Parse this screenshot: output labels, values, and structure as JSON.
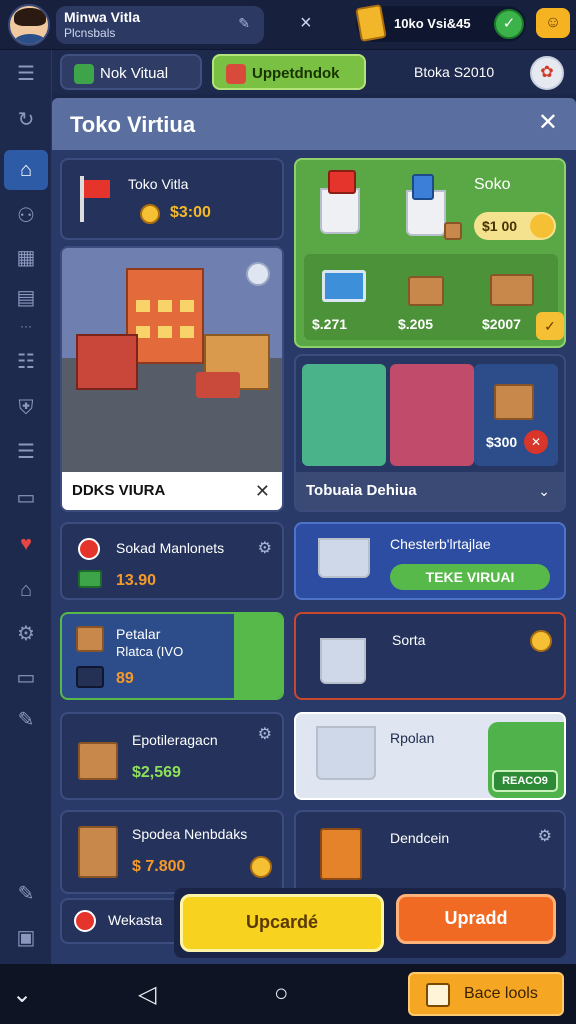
{
  "topbar": {
    "profile_name": "Minwa Vitla",
    "profile_sub": "Plcnsbals",
    "profile_edit_icon": "pencil-icon",
    "close_symbol": "×",
    "balance": "10ko Vsi&45",
    "badge_icon": "checkmark-icon",
    "chat_icon": "chat-bubble-icon",
    "edit_glyph": "✎",
    "badge_glyph": "✓",
    "chat_glyph": "☺"
  },
  "tabs": {
    "store": "Nok Vitual",
    "upgrade": "Uppetdndok",
    "balance": "Btoka S2010",
    "gift_glyph": "✿"
  },
  "sidebar": {
    "items": [
      {
        "name": "menu-icon",
        "glyph": "☰"
      },
      {
        "name": "refresh-icon",
        "glyph": "↻"
      },
      {
        "name": "home-icon",
        "glyph": "⌂"
      },
      {
        "name": "people-icon",
        "glyph": "⚇"
      },
      {
        "name": "building-icon",
        "glyph": "▦"
      },
      {
        "name": "chart-icon",
        "glyph": "▤"
      },
      {
        "name": "dots-icon",
        "glyph": "···"
      },
      {
        "name": "list-icon",
        "glyph": "☷"
      },
      {
        "name": "shield-icon",
        "glyph": "⛨"
      },
      {
        "name": "document-icon",
        "glyph": "☰"
      },
      {
        "name": "box-icon",
        "glyph": "▭"
      },
      {
        "name": "heart-icon",
        "glyph": "♥"
      },
      {
        "name": "store-icon",
        "glyph": "⌂"
      },
      {
        "name": "settings-icon",
        "glyph": "⚙"
      },
      {
        "name": "monitor-icon",
        "glyph": "▭"
      },
      {
        "name": "wrench-icon",
        "glyph": "✎"
      },
      {
        "name": "edit-icon",
        "glyph": "✎"
      },
      {
        "name": "save-icon",
        "glyph": "▣"
      }
    ]
  },
  "panel": {
    "title": "Toko Virtiua",
    "close_symbol": "✕"
  },
  "cards": {
    "store_flag": {
      "title": "Toko Vitla",
      "price": "$3:00"
    },
    "soko": {
      "title": "Soko",
      "price": "$1 00",
      "values": [
        "$.271",
        "$.205",
        "$2007"
      ],
      "check": "✓"
    },
    "city": {
      "caption": "DDKS VIURA",
      "close": "✕"
    },
    "shops": {
      "caption": "Tobuaia Dehiua",
      "price": "$300",
      "chevron": "⌄",
      "close": "✕"
    },
    "sokad": {
      "title": "Sokad Manlonets",
      "price": "13.90"
    },
    "cheste": {
      "title": "Chesterb'lrtajlae",
      "button": "TEKE VIRUAI"
    },
    "petalar": {
      "title": "Petalar",
      "subtitle": "Rlatca (IVO",
      "price": "89"
    },
    "sorta": {
      "title": "Sorta"
    },
    "epotilera": {
      "title": "Epotileragacn",
      "price": "$2,569"
    },
    "rpolan": {
      "title": "Rpolan",
      "badge": "REACO9"
    },
    "spodea": {
      "title": "Spodea Nenbdaks",
      "price": "$ 7.800"
    },
    "dendcein": {
      "title": "Dendcein"
    },
    "wekasta": {
      "title": "Wekasta"
    }
  },
  "actions": {
    "upgrade_yellow": "Upcardé",
    "upgrade_orange": "Upradd"
  },
  "navbar": {
    "back": "◁",
    "home": "○",
    "menu": "⌄",
    "bundle": "Bace lools"
  },
  "colors": {
    "accent_green": "#7ac043",
    "accent_yellow": "#f7d21e",
    "accent_orange": "#f16a23",
    "panel_bg": "#2a3a68",
    "price_gold": "#f5b829"
  }
}
